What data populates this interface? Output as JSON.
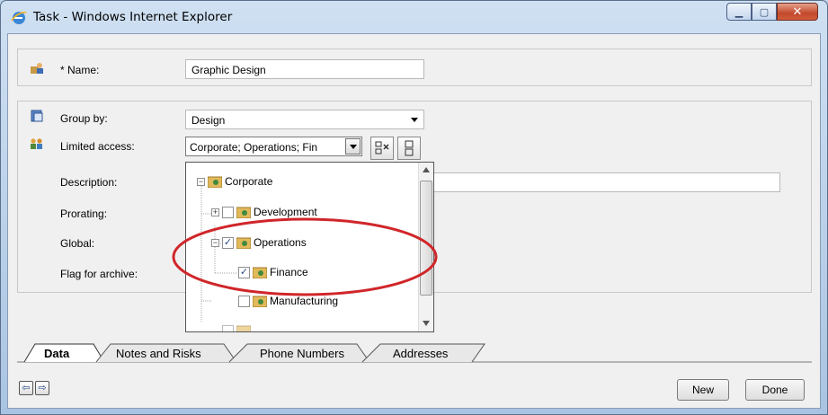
{
  "window": {
    "title": "Task - Windows Internet Explorer"
  },
  "form": {
    "name_label": "* Name:",
    "name_value": "Graphic Design",
    "group_by_label": "Group by:",
    "group_by_value": "Design",
    "limited_access_label": "Limited access:",
    "limited_access_value": "Corporate; Operations; Fin",
    "description_label": "Description:",
    "prorating_label": "Prorating:",
    "global_label": "Global:",
    "flag_archive_label": "Flag for archive:"
  },
  "tree": {
    "items": [
      {
        "label": "Corporate",
        "expanded": true,
        "checked": false
      },
      {
        "label": "Development",
        "expanded": false,
        "checked": false
      },
      {
        "label": "Operations",
        "expanded": true,
        "checked": true
      },
      {
        "label": "Finance",
        "checked": true
      },
      {
        "label": "Manufacturing",
        "checked": false
      }
    ]
  },
  "tabs": [
    {
      "label": "Data",
      "active": true
    },
    {
      "label": "Notes and Risks",
      "active": false
    },
    {
      "label": "Phone Numbers",
      "active": false
    },
    {
      "label": "Addresses",
      "active": false
    }
  ],
  "buttons": {
    "new": "New",
    "done": "Done"
  },
  "colors": {
    "highlight_ellipse": "#d0262a",
    "title_bar": "#bcd3ea"
  },
  "icons": [
    "ie-logo-icon",
    "task-user-icon",
    "group-icon",
    "people-icon",
    "expand-all-icon",
    "collapse-all-icon",
    "back-arrow-icon",
    "forward-arrow-icon"
  ]
}
